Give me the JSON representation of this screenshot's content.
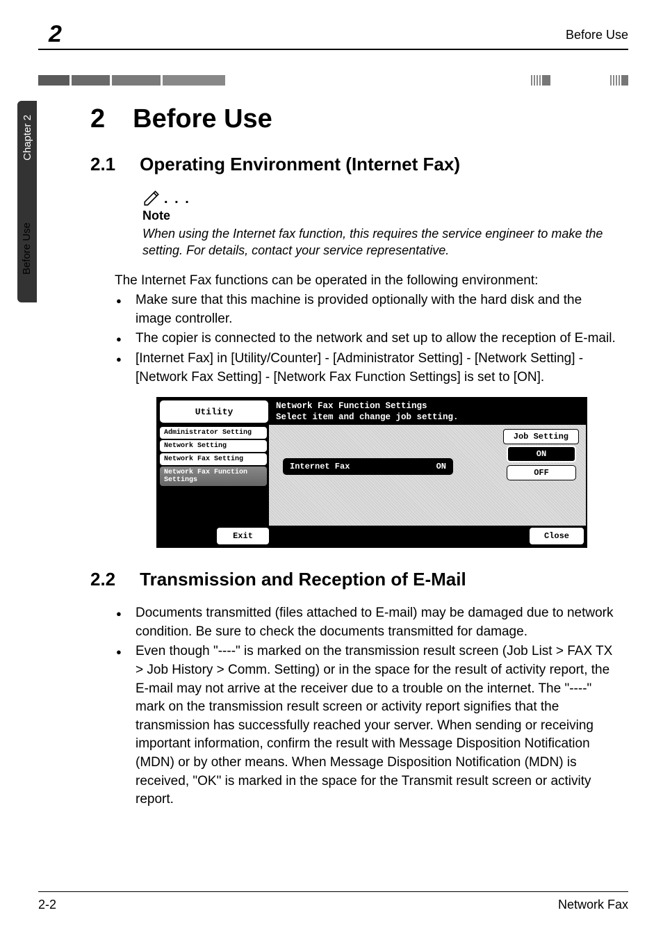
{
  "header": {
    "chapter_number": "2",
    "right_text": "Before Use"
  },
  "sidebar": {
    "top_text": "Chapter 2",
    "bottom_text": "Before Use"
  },
  "chapter": {
    "number": "2",
    "title": "Before Use"
  },
  "section1": {
    "number": "2.1",
    "title": "Operating Environment (Internet Fax)",
    "note_label": "Note",
    "note_text": "When using the Internet fax function, this requires the service engineer to make the setting. For details, contact your service representative.",
    "intro": "The Internet Fax functions can be operated in the following environment:",
    "bullets": [
      "Make sure that this machine is provided optionally with the hard disk and the image controller.",
      "The copier is connected to the network and set up to allow the reception of E-mail.",
      "[Internet Fax] in [Utility/Counter] - [Administrator Setting] - [Network Setting] - [Network Fax Setting] - [Network Fax Function Settings] is set to [ON]."
    ]
  },
  "device_screen": {
    "utility_label": "Utility",
    "title_line1": "Network Fax Function Settings",
    "title_line2": "Select item and change job setting.",
    "breadcrumb": [
      "Administrator Setting",
      "Network Setting",
      "Network Fax Setting",
      "Network Fax Function Settings"
    ],
    "job_setting_label": "Job Setting",
    "button_label": "Internet Fax",
    "button_state": "ON",
    "on_label": "ON",
    "off_label": "OFF",
    "exit_label": "Exit",
    "close_label": "Close"
  },
  "section2": {
    "number": "2.2",
    "title": "Transmission and Reception of E-Mail",
    "bullets": [
      "Documents transmitted (files attached to E-mail) may be damaged due to network condition. Be sure to check the documents transmitted for damage.",
      "Even though \"----\" is marked on the transmission result screen (Job List > FAX TX > Job History > Comm. Setting) or in the space for the result of activity report, the E-mail may not arrive at the receiver due to a trouble on the internet. The \"----\" mark on the transmission result screen or activity report signifies that the transmission has successfully reached your server. When sending or receiving important information, confirm the result with Message Disposition Notification (MDN) or by other means. When Message Disposition Notification (MDN) is received, \"OK\" is marked in the space for the Transmit result screen or activity report."
    ]
  },
  "footer": {
    "left": "2-2",
    "right": "Network Fax"
  }
}
